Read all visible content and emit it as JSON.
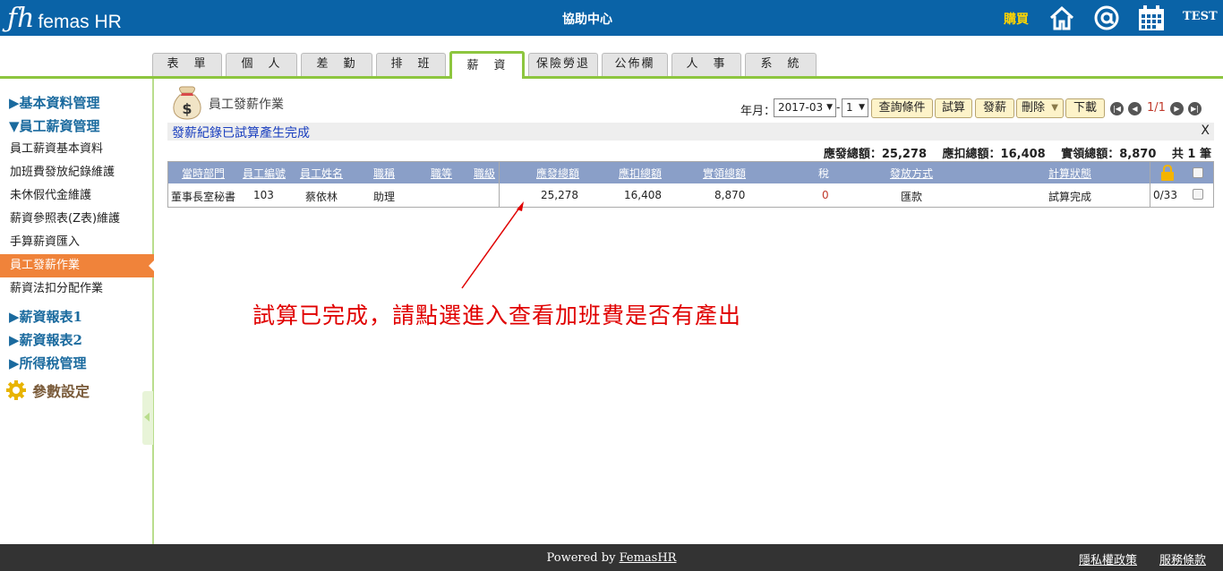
{
  "header": {
    "logo_mark": "ƒh",
    "logo_text": "femas HR",
    "title": "協助中心",
    "buy_label": "購買",
    "user": "TEST",
    "icons": [
      "home-icon",
      "at-icon",
      "calendar-icon"
    ]
  },
  "tabs": [
    "表　單",
    "個　人",
    "差　勤",
    "排　班",
    "薪　資",
    "保險勞退",
    "公佈欄",
    "人　事",
    "系　統"
  ],
  "active_tab": "薪　資",
  "sidebar": {
    "sections": {
      "basic": "▶基本資料管理",
      "salary": "▼員工薪資管理",
      "report1": "▶薪資報表1",
      "report2": "▶薪資報表2",
      "tax": "▶所得稅管理",
      "params": "參數設定"
    },
    "items": [
      "員工薪資基本資料",
      "加班費發放紀錄維護",
      "未休假代金維護",
      "薪資參照表(Z表)維護",
      "手算薪資匯入",
      "員工發薪作業",
      "薪資法扣分配作業"
    ],
    "active_item": "員工發薪作業"
  },
  "page": {
    "title": "員工發薪作業",
    "ym_label": "年月：",
    "ym_value": "2017-03",
    "period_sep": "-",
    "period_value": "1",
    "buttons": {
      "query": "查詢條件",
      "trial": "試算",
      "pay": "發薪",
      "delete": "刪除",
      "download": "下載"
    },
    "page_info": "1/1",
    "message": "發薪紀錄已試算產生完成",
    "message_close": "X",
    "summary": "應發總額：25,278　 應扣總額：16,408　 實領總額：8,870　 共 1 筆"
  },
  "table": {
    "headers": {
      "dept": "當時部門",
      "emp_no": "員工編號",
      "emp_name": "員工姓名",
      "title": "職稱",
      "rank": "職等",
      "level": "職級",
      "gross": "應發總額",
      "deduct": "應扣總額",
      "net": "實領總額",
      "tax": "稅",
      "method": "發放方式",
      "status": "計算狀態"
    },
    "rows": [
      {
        "dept": "董事長室秘書",
        "emp_no": "103",
        "emp_name": "蔡依林",
        "title": "助理",
        "rank": "",
        "level": "",
        "gross": "25,278",
        "deduct": "16,408",
        "net": "8,870",
        "tax": "0",
        "method": "匯款",
        "status": "試算完成",
        "lock": "0/33"
      }
    ]
  },
  "annotation": "試算已完成，請點選進入查看加班費是否有產出",
  "footer": {
    "powered_prefix": "Powered by ",
    "powered_link": "FemasHR",
    "privacy": "隱私權政策",
    "terms": "服務條款"
  }
}
